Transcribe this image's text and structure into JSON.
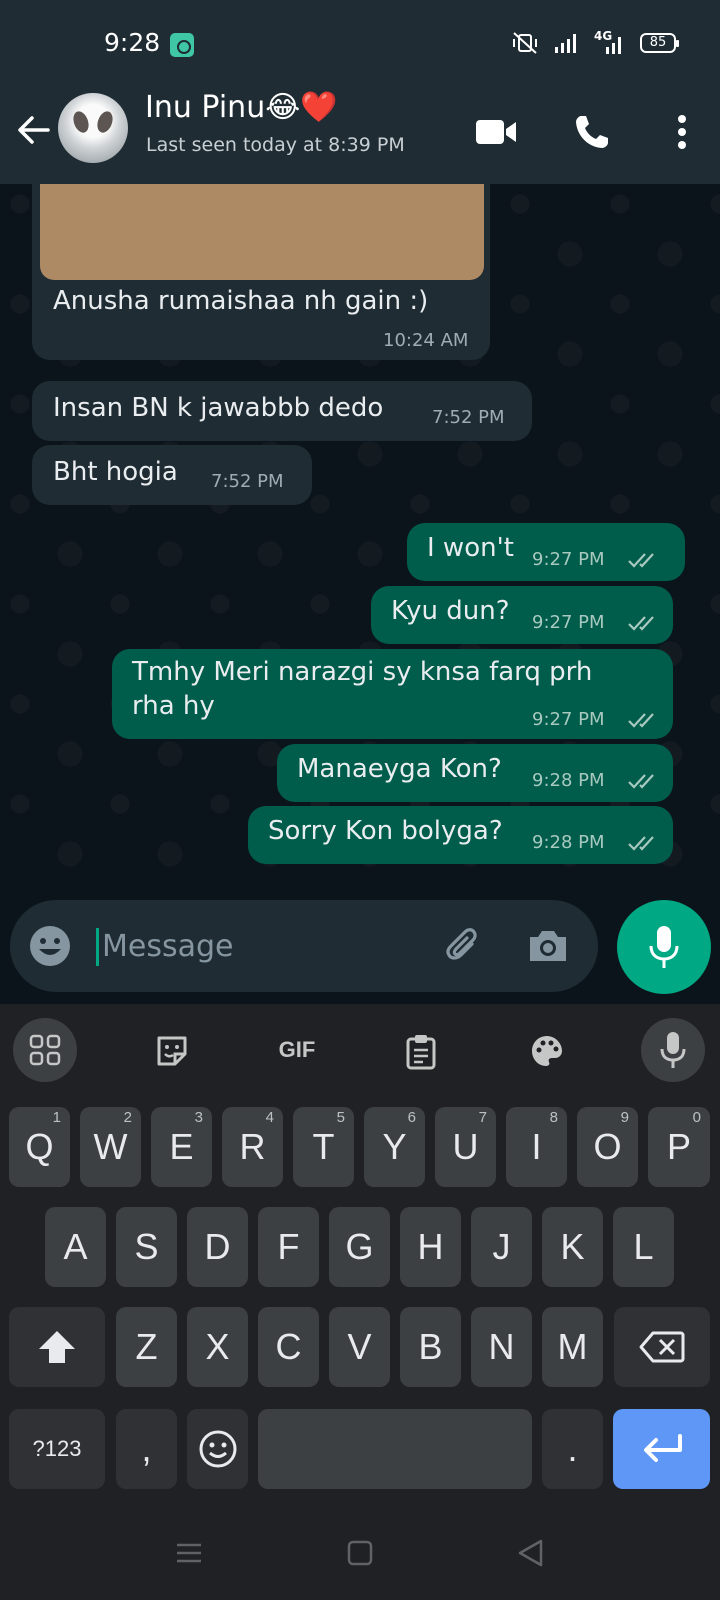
{
  "status_bar": {
    "time": "9:28",
    "network": "4G",
    "battery": "85"
  },
  "header": {
    "contact_name": "Inu Pinu😂❤️",
    "last_seen": "Last seen today at 8:39 PM"
  },
  "messages": [
    {
      "direction": "in",
      "text": "Anusha rumaishaa nh gain :)",
      "time": "10:24 AM",
      "has_image": true
    },
    {
      "direction": "in",
      "text": "Insan BN k jawabbb dedo",
      "time": "7:52 PM"
    },
    {
      "direction": "in",
      "text": "Bht hogia",
      "time": "7:52 PM"
    },
    {
      "direction": "out",
      "text": "I won't",
      "time": "9:27 PM",
      "status": "read"
    },
    {
      "direction": "out",
      "text": "Kyu dun?",
      "time": "9:27 PM",
      "status": "read"
    },
    {
      "direction": "out",
      "text_line1": "Tmhy Meri narazgi sy knsa farq prh",
      "text_line2": "rha hy",
      "time": "9:27 PM",
      "status": "read"
    },
    {
      "direction": "out",
      "text": "Manaeyga Kon?",
      "time": "9:28 PM",
      "status": "read"
    },
    {
      "direction": "out",
      "text": "Sorry Kon bolyga?",
      "time": "9:28 PM",
      "status": "read"
    }
  ],
  "composer": {
    "placeholder": "Message"
  },
  "keyboard": {
    "toolbar": {
      "gif_label": "GIF"
    },
    "row1": [
      {
        "key": "Q",
        "hint": "1"
      },
      {
        "key": "W",
        "hint": "2"
      },
      {
        "key": "E",
        "hint": "3"
      },
      {
        "key": "R",
        "hint": "4"
      },
      {
        "key": "T",
        "hint": "5"
      },
      {
        "key": "Y",
        "hint": "6"
      },
      {
        "key": "U",
        "hint": "7"
      },
      {
        "key": "I",
        "hint": "8"
      },
      {
        "key": "O",
        "hint": "9"
      },
      {
        "key": "P",
        "hint": "0"
      }
    ],
    "row2": [
      "A",
      "S",
      "D",
      "F",
      "G",
      "H",
      "J",
      "K",
      "L"
    ],
    "row3": [
      "Z",
      "X",
      "C",
      "V",
      "B",
      "N",
      "M"
    ],
    "symbols_label": "?123",
    "comma": ",",
    "period": "."
  },
  "colors": {
    "incoming_bubble": "#1f2c34",
    "outgoing_bubble": "#005c4b",
    "accent": "#00a884",
    "enter_key": "#5e97f6"
  }
}
